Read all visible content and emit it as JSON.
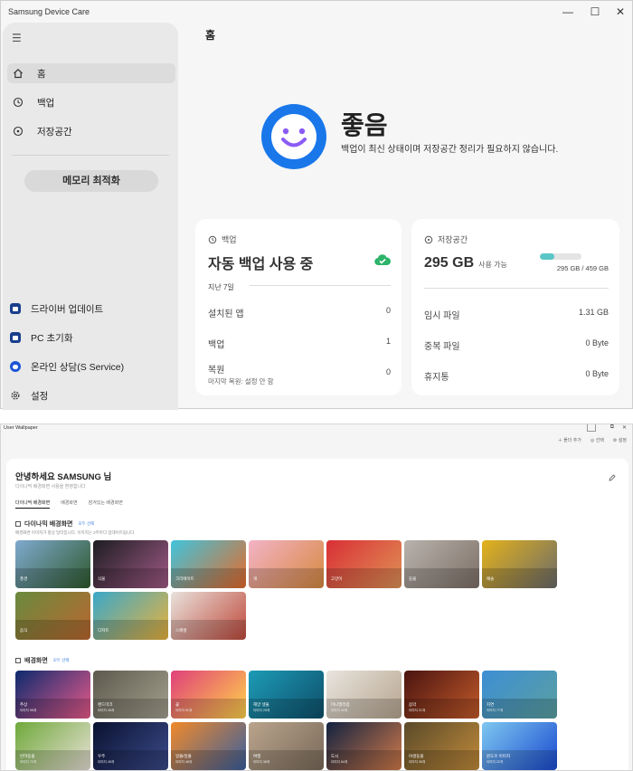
{
  "device_care": {
    "title": "Samsung Device Care",
    "window_controls": {
      "minimize": "—",
      "maximize": "☐",
      "close": "✕"
    },
    "nav": [
      {
        "label": "홈",
        "icon": "home-icon"
      },
      {
        "label": "백업",
        "icon": "history-icon"
      },
      {
        "label": "저장공간",
        "icon": "storage-icon"
      }
    ],
    "memory_button": "메모리 최적화",
    "bottom_nav": [
      {
        "label": "드라이버 업데이트",
        "icon": "driver-update-icon"
      },
      {
        "label": "PC 초기화",
        "icon": "pc-reset-icon"
      },
      {
        "label": "온라인 상담(S Service)",
        "icon": "chat-icon"
      },
      {
        "label": "설정",
        "icon": "gear-icon"
      }
    ],
    "page_title": "홈",
    "status": {
      "title": "좋음",
      "description": "백업이 최신 상태이며 저장공간 정리가 필요하지 않습니다.",
      "icon": "smile-icon",
      "color": "#1977ea"
    },
    "backup_card": {
      "header": "백업",
      "title": "자동 백업 사용 중",
      "period": "지난 7일",
      "rows": [
        {
          "label": "설치된 앱",
          "value": "0"
        },
        {
          "label": "백업",
          "value": "1"
        },
        {
          "label": "복원",
          "sub": "마지막 복원: 설정 안 함",
          "value": "0"
        }
      ]
    },
    "storage_card": {
      "header": "저장공간",
      "value": "295 GB",
      "available": "사용 가능",
      "usage": "295 GB / 459 GB",
      "usage_fraction": 0.357,
      "bar_color": "#5bc6c6",
      "rows": [
        {
          "label": "임시 파일",
          "value": "1.31 GB"
        },
        {
          "label": "중복 파일",
          "value": "0 Byte"
        },
        {
          "label": "휴지통",
          "value": "0 Byte"
        }
      ]
    }
  },
  "wallpaper": {
    "title": "User Wallpaper",
    "top_actions": [
      "폴더 추가",
      "선택",
      "설정"
    ],
    "greeting": "안녕하세요  SAMSUNG  님",
    "greeting_sub": "다이나믹 배경화면 사용을 환영합니다",
    "tabs": [
      "다이나믹 배경화면",
      "배경화면",
      "잠겨있는 배경화면"
    ],
    "dynamic": {
      "header": "다이나믹 배경화면",
      "link": "모두 선택",
      "sub": "배경화면 이미지가 항상 달라집니다. 이미지는 2주마다 업데이트됩니다.",
      "tiles": [
        {
          "label": "풍경",
          "colors": [
            "#7fa9cf",
            "#2f5a2e"
          ]
        },
        {
          "label": "식물",
          "colors": [
            "#1d1d22",
            "#a05a86"
          ]
        },
        {
          "label": "크리에이트",
          "colors": [
            "#40c4dc",
            "#e56a2a"
          ]
        },
        {
          "label": "개",
          "colors": [
            "#f3b3c7",
            "#d7893f"
          ]
        },
        {
          "label": "고양이",
          "colors": [
            "#d92f36",
            "#e09256"
          ]
        },
        {
          "label": "동물",
          "colors": [
            "#b8b2ac",
            "#7c6f66"
          ]
        },
        {
          "label": "예술",
          "colors": [
            "#e3b21b",
            "#6b6b6b"
          ]
        },
        {
          "label": "음식",
          "colors": [
            "#6a8a3e",
            "#b9672f"
          ]
        },
        {
          "label": "디저트",
          "colors": [
            "#3aa8c9",
            "#e8b23d"
          ]
        },
        {
          "label": "스페셜",
          "colors": [
            "#e8e2dc",
            "#c04a3c"
          ]
        }
      ]
    },
    "static": {
      "header": "배경화면",
      "link": "모두 선택",
      "tiles": [
        {
          "label": "추상",
          "sub": "이미지 96개",
          "colors": [
            "#0c2a6e",
            "#e85a8a"
          ]
        },
        {
          "label": "랜드마크",
          "sub": "이미지 46개",
          "colors": [
            "#5d5a4e",
            "#a3a08e"
          ]
        },
        {
          "label": "꽃",
          "sub": "이미지 51개",
          "colors": [
            "#e0407a",
            "#ffd24a"
          ]
        },
        {
          "label": "해양 생물",
          "sub": "이미지 25개",
          "colors": [
            "#1d9bb6",
            "#0e4f6a"
          ]
        },
        {
          "label": "미니멀리즘",
          "sub": "이미지 34개",
          "colors": [
            "#e8e4de",
            "#b7a58f"
          ]
        },
        {
          "label": "음악",
          "sub": "이미지 21개",
          "colors": [
            "#4a1410",
            "#c25a2a"
          ]
        },
        {
          "label": "자연",
          "sub": "이미지 77개",
          "colors": [
            "#3d8ed4",
            "#5aa0a0"
          ]
        },
        {
          "label": "반려동물",
          "sub": "이미지 72개",
          "colors": [
            "#6fa93a",
            "#e8e0d6"
          ]
        },
        {
          "label": "우주",
          "sub": "이미지 45개",
          "colors": [
            "#0a1230",
            "#3b4a8a"
          ]
        },
        {
          "label": "일몰/일출",
          "sub": "이미지 48개",
          "colors": [
            "#f08a2a",
            "#3b5f9e"
          ]
        },
        {
          "label": "여행",
          "sub": "이미지 38개",
          "colors": [
            "#b9a48c",
            "#7a6a5a"
          ]
        },
        {
          "label": "도시",
          "sub": "이미지 64개",
          "colors": [
            "#122240",
            "#d07a4a"
          ]
        },
        {
          "label": "야생동물",
          "sub": "이미지 39개",
          "colors": [
            "#5a4a2a",
            "#c08a3a"
          ]
        },
        {
          "label": "윈도우 이미지",
          "sub": "이미지 22개",
          "colors": [
            "#7ec8f0",
            "#1a4ad0"
          ]
        }
      ]
    }
  }
}
